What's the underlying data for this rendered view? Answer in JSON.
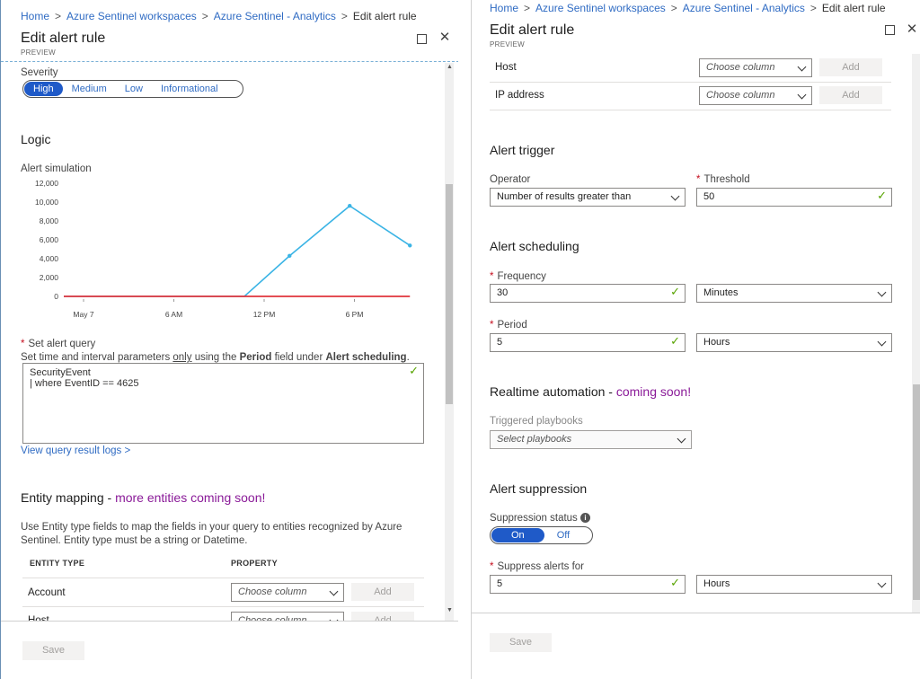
{
  "breadcrumb": {
    "home": "Home",
    "workspaces": "Azure Sentinel workspaces",
    "analytics": "Azure Sentinel - Analytics",
    "current": "Edit alert rule"
  },
  "blade": {
    "title": "Edit alert rule",
    "subtitle": "PREVIEW"
  },
  "severity": {
    "label": "Severity",
    "options": [
      "High",
      "Medium",
      "Low",
      "Informational"
    ],
    "selected": "High"
  },
  "logic": {
    "heading": "Logic",
    "simulation_label": "Alert simulation"
  },
  "chart_data": {
    "type": "line",
    "title": "",
    "xlabel": "",
    "ylabel": "",
    "ylim": [
      0,
      12000
    ],
    "y_ticks": [
      "12,000",
      "10,000",
      "8,000",
      "6,000",
      "4,000",
      "2,000",
      "0"
    ],
    "x_ticks": [
      "May 7",
      "6 AM",
      "12 PM",
      "6 PM"
    ],
    "series": [
      {
        "color": "#3bb4e5",
        "x": [
          "00:00",
          "07:00",
          "12:00",
          "15:00",
          "19:00",
          "23:00"
        ],
        "values": [
          0,
          0,
          0,
          4300,
          9600,
          5400
        ]
      },
      {
        "color": "#e0343c",
        "x": [
          "00:00",
          "23:00"
        ],
        "values": [
          0,
          0
        ]
      }
    ]
  },
  "query": {
    "label": "Set alert query",
    "hint_prefix": "Set time and interval parameters ",
    "hint_only": "only",
    "hint_mid": " using the ",
    "hint_period": "Period",
    "hint_mid2": " field under ",
    "hint_sched": "Alert scheduling",
    "hint_end": ".",
    "line1": "SecurityEvent",
    "line2": "| where EventID == 4625",
    "view_logs": "View query result logs >"
  },
  "entity": {
    "heading": "Entity mapping - ",
    "heading_soon": "more entities coming soon!",
    "description": "Use Entity type fields to map the fields in your query to entities recognized by Azure Sentinel. Entity type must be a string or Datetime.",
    "col_type": "ENTITY TYPE",
    "col_property": "PROPERTY",
    "rows": [
      {
        "type": "Account",
        "placeholder": "Choose column",
        "add": "Add"
      },
      {
        "type": "Host",
        "placeholder": "Choose column",
        "add": "Add"
      },
      {
        "type": "IP address",
        "placeholder": "Choose column",
        "add": "Add"
      }
    ]
  },
  "trigger": {
    "heading": "Alert trigger",
    "operator_label": "Operator",
    "operator_value": "Number of results greater than",
    "threshold_label": "Threshold",
    "threshold_value": "50"
  },
  "scheduling": {
    "heading": "Alert scheduling",
    "frequency_label": "Frequency",
    "frequency_value": "30",
    "frequency_unit": "Minutes",
    "period_label": "Period",
    "period_value": "5",
    "period_unit": "Hours"
  },
  "automation": {
    "heading": "Realtime automation - ",
    "soon": "coming soon!",
    "playbooks_label": "Triggered playbooks",
    "playbooks_placeholder": "Select playbooks"
  },
  "suppression": {
    "heading": "Alert suppression",
    "status_label": "Suppression status",
    "on": "On",
    "off": "Off",
    "suppress_label": "Suppress alerts for",
    "suppress_value": "5",
    "suppress_unit": "Hours"
  },
  "footer": {
    "save": "Save"
  },
  "colors": {
    "link": "#2f6bc3",
    "accent": "#1f5ac8",
    "valid": "#57a300",
    "soon": "#8a1a98"
  }
}
